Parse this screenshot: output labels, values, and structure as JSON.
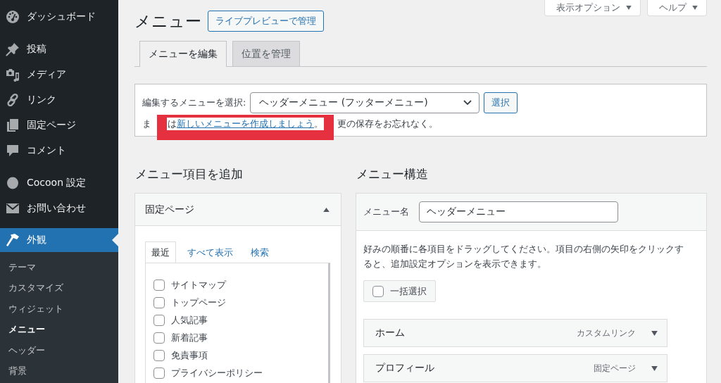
{
  "sidebar": {
    "groups": [
      {
        "items": [
          {
            "label": "ダッシュボード",
            "selected": false
          }
        ]
      },
      {
        "items": [
          {
            "label": "投稿",
            "selected": false
          },
          {
            "label": "メディア",
            "selected": false
          },
          {
            "label": "リンク",
            "selected": false
          },
          {
            "label": "固定ページ",
            "selected": false
          },
          {
            "label": "コメント",
            "selected": false
          }
        ]
      },
      {
        "items": [
          {
            "label": "Cocoon 設定",
            "selected": false
          },
          {
            "label": "お問い合わせ",
            "selected": false
          }
        ]
      },
      {
        "items": [
          {
            "label": "外観",
            "selected": true,
            "children": [
              {
                "label": "テーマ",
                "selected": false
              },
              {
                "label": "カスタマイズ",
                "selected": false
              },
              {
                "label": "ウィジェット",
                "selected": false
              },
              {
                "label": "メニュー",
                "selected": true
              },
              {
                "label": "ヘッダー",
                "selected": false
              },
              {
                "label": "背景",
                "selected": false
              }
            ]
          }
        ]
      }
    ]
  },
  "screen_links": [
    {
      "label": "表示オプション"
    },
    {
      "label": "ヘルプ"
    }
  ],
  "page": {
    "title": "メニュー",
    "action": "ライブプレビューで管理"
  },
  "tabs": [
    {
      "label": "メニューを編集",
      "selected": true
    },
    {
      "label": "位置を管理",
      "selected": false
    }
  ],
  "manage": {
    "label": "編集するメニューを選択:",
    "select": {
      "value": "ヘッダーメニュー (フッターメニュー)"
    },
    "button": "選択",
    "notice": {
      "before": "ま",
      "highlight": {
        "before": "は",
        "link": "新しいメニューを作成しましょう",
        "after": "。"
      },
      "after": "更の保存をお忘れなく。"
    }
  },
  "add_items": {
    "title": "メニュー項目を追加",
    "section": {
      "title": "固定ページ",
      "expanded": true,
      "tabs": [
        {
          "label": "最近",
          "selected": true
        },
        {
          "label": "すべて表示",
          "selected": false
        },
        {
          "label": "検索",
          "selected": false
        }
      ],
      "pages": [
        {
          "label": "サイトマップ",
          "checked": false
        },
        {
          "label": "トップページ",
          "checked": false
        },
        {
          "label": "人気記事",
          "checked": false
        },
        {
          "label": "新着記事",
          "checked": false
        },
        {
          "label": "免責事項",
          "checked": false
        },
        {
          "label": "プライバシーポリシー",
          "checked": false
        }
      ]
    }
  },
  "structure": {
    "title": "メニュー構造",
    "name_label": "メニュー名",
    "name_value": "ヘッダーメニュー",
    "instructions": "好みの順番に各項目をドラッグしてください。項目の右側の矢印をクリックすると、追加設定オプションを表示できます。",
    "bulk_select": {
      "label": "一括選択",
      "checked": false
    },
    "items": [
      {
        "title": "ホーム",
        "type": "カスタムリンク"
      },
      {
        "title": "プロフィール",
        "type": "固定ページ"
      }
    ]
  }
}
